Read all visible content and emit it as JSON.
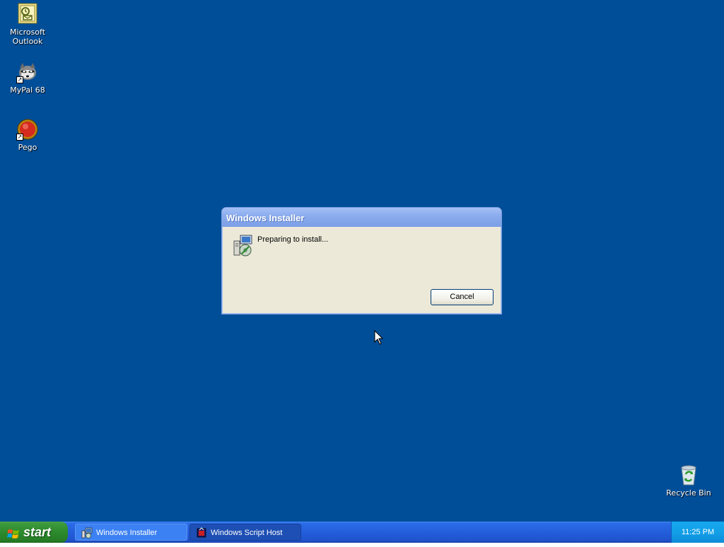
{
  "desktop": {
    "background_color": "#004e98",
    "icons": [
      {
        "label": "Microsoft Outlook",
        "icon": "outlook-icon"
      },
      {
        "label": "MyPal 68",
        "icon": "mypal-icon"
      },
      {
        "label": "Pego",
        "icon": "pego-icon"
      },
      {
        "label": "Recycle Bin",
        "icon": "recycle-bin-icon"
      }
    ]
  },
  "dialog": {
    "title": "Windows Installer",
    "message": "Preparing to install...",
    "cancel_label": "Cancel",
    "icon": "installer-icon"
  },
  "taskbar": {
    "start_label": "start",
    "tasks": [
      {
        "label": "Windows Installer",
        "icon": "installer-icon",
        "active": true
      },
      {
        "label": "Windows Script Host",
        "icon": "script-host-icon",
        "active": false
      }
    ],
    "clock": "11:25 PM"
  }
}
